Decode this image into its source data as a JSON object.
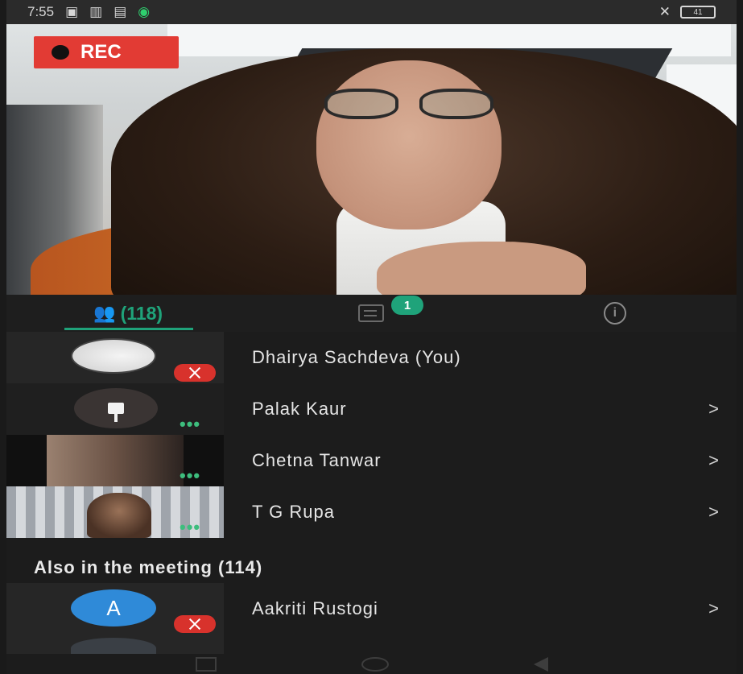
{
  "status_bar": {
    "time": "7:55",
    "icons_left": [
      "sim-icon",
      "signal-icon",
      "data-icon",
      "whatsapp-icon"
    ],
    "icons_right": [
      "mute-icon",
      "battery-icon"
    ],
    "battery": "41"
  },
  "recording": {
    "label": "REC"
  },
  "tabs": {
    "people_count": "(118)",
    "chat_unread": "1"
  },
  "participants": [
    {
      "name": "Dhairya Sachdeva (You)",
      "muted": true
    },
    {
      "name": "Palak Kaur",
      "pinned": true
    },
    {
      "name": "Chetna Tanwar"
    },
    {
      "name": "T G Rupa"
    }
  ],
  "also_in_meeting": {
    "heading": "Also in the meeting (114)",
    "people": [
      {
        "name": "Aakriti Rustogi",
        "initial": "A",
        "muted": true
      }
    ]
  },
  "chevron": ">",
  "colors": {
    "accent": "#1fa37a",
    "rec": "#e23b34",
    "mute": "#d8322c",
    "avatar_blue": "#2f8ad8"
  }
}
